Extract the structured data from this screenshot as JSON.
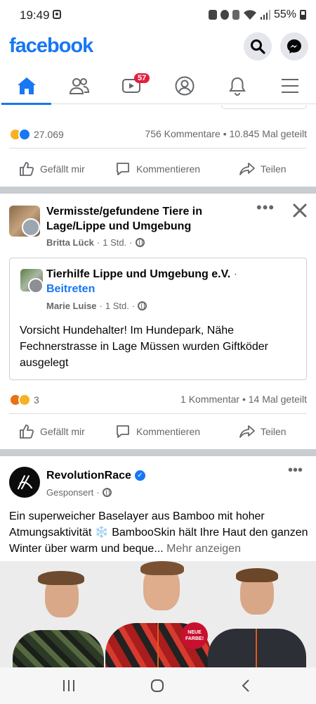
{
  "status": {
    "time": "19:49",
    "battery": "55%"
  },
  "app": {
    "logo": "facebook"
  },
  "nav": {
    "watch_badge": "57"
  },
  "top_post": {
    "reaction_count": "27.069",
    "stats": "756 Kommentare • 10.845 Mal geteilt"
  },
  "actions": {
    "like": "Gefällt mir",
    "comment": "Kommentieren",
    "share": "Teilen"
  },
  "group_post": {
    "group_name": "Vermisste/gefundene Tiere in Lage/Lippe und Umgebung",
    "author": "Britta Lück",
    "time": "1 Std.",
    "shared": {
      "group_name": "Tierhilfe Lippe und Umgebung e.V.",
      "join": "Beitreten",
      "author": "Marie Luise",
      "time": "1 Std.",
      "text": "Vorsicht Hundehalter! Im Hundepark, Nähe Fechnerstrasse in Lage Müssen wurden Giftköder ausgelegt"
    },
    "reaction_count": "3",
    "stats": "1 Kommentar • 14 Mal geteilt"
  },
  "ad_post": {
    "name": "RevolutionRace",
    "sponsored": "Gesponsert",
    "text": "Ein superweicher Baselayer aus Bamboo mit hoher Atmungsaktivität ❄️ BambooSkin hält Ihre Haut den ganzen Winter über warm und beque...",
    "more": "Mehr anzeigen",
    "sticker": "NEUE FARBE!"
  },
  "colors": {
    "brand": "#1877f2",
    "badge": "#e41e3f",
    "divider": "#c9ccd1"
  }
}
